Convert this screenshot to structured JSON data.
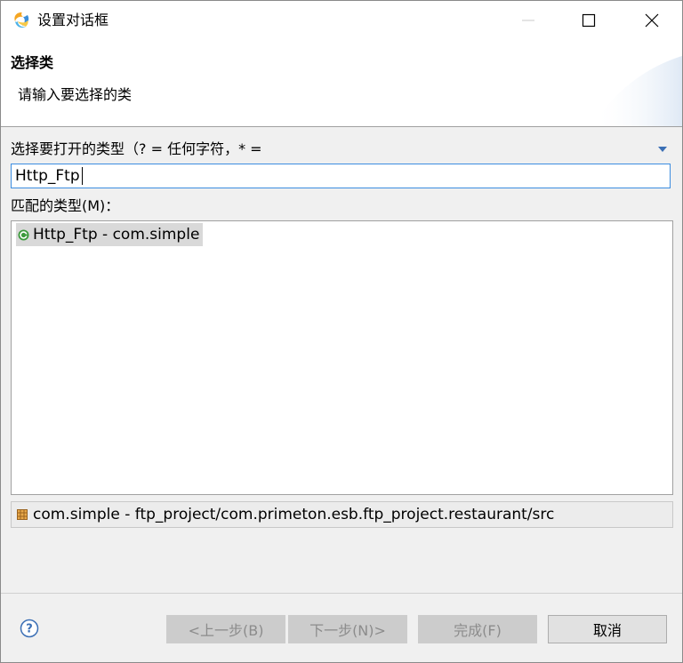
{
  "window": {
    "title": "设置对话框"
  },
  "header": {
    "title": "选择类",
    "message": "请输入要选择的类"
  },
  "filter": {
    "label": "选择要打开的类型（? = 任何字符，* =",
    "value": "Http_Ftp"
  },
  "matches": {
    "label": "匹配的类型(M)：",
    "items": [
      {
        "label": "Http_Ftp - com.simple",
        "icon": "class-icon",
        "selected": true
      }
    ]
  },
  "status": {
    "text": "com.simple - ftp_project/com.primeton.esb.ftp_project.restaurant/src",
    "icon": "package-icon"
  },
  "buttons": {
    "back": "<上一步(B)",
    "next": "下一步(N)>",
    "finish": "完成(F)",
    "cancel": "取消"
  },
  "colors": {
    "focus_border": "#3c8de0",
    "selection": "#d9d9d9",
    "disabled_button": "#cccccc",
    "disabled_text": "#8c8c8c",
    "class_icon": "#3c9a3c"
  }
}
